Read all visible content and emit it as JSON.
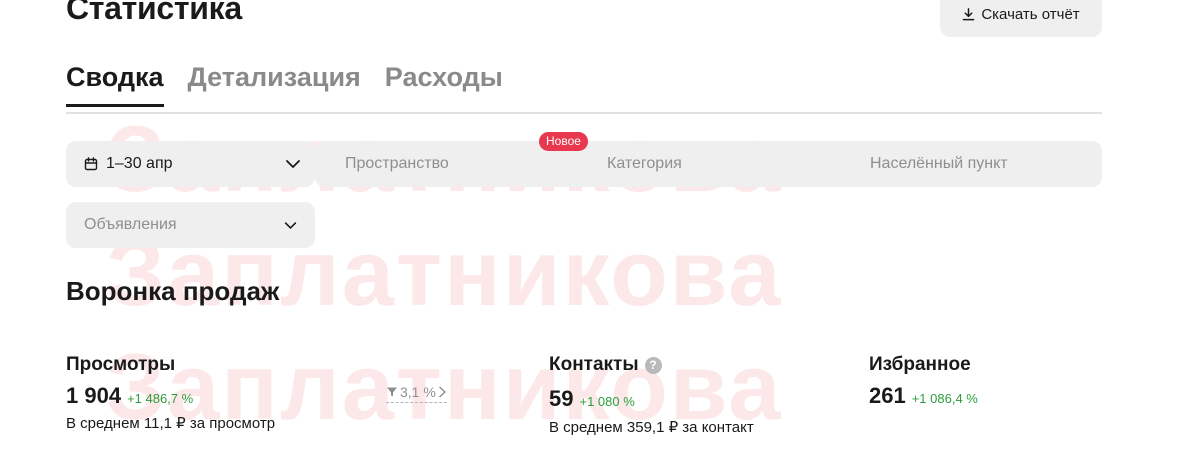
{
  "header": {
    "title": "Статистика",
    "download_label": "Скачать отчёт"
  },
  "tabs": [
    {
      "label": "Сводка",
      "active": true
    },
    {
      "label": "Детализация",
      "active": false
    },
    {
      "label": "Расходы",
      "active": false
    }
  ],
  "filters": {
    "date_range": "1–30 апр",
    "space_placeholder": "Пространство",
    "new_badge": "Новое",
    "category_placeholder": "Категория",
    "city_placeholder": "Населённый пункт",
    "ads_placeholder": "Объявления"
  },
  "funnel": {
    "title": "Воронка продаж",
    "views": {
      "label": "Просмотры",
      "value": "1 904",
      "delta": "+1 486,7 %",
      "avg": "В среднем 11,1 ₽ за просмотр"
    },
    "conversion": "3,1 %",
    "contacts": {
      "label": "Контакты",
      "help": "?",
      "value": "59",
      "delta": "+1 080 %",
      "avg": "В среднем 359,1 ₽ за контакт"
    },
    "favorites": {
      "label": "Избранное",
      "value": "261",
      "delta": "+1 086,4 %"
    }
  },
  "watermark": "Заплатникова",
  "colors": {
    "accent_badge": "#e8374e",
    "positive_delta": "#2d9e3d",
    "filter_bg": "#efefef"
  }
}
